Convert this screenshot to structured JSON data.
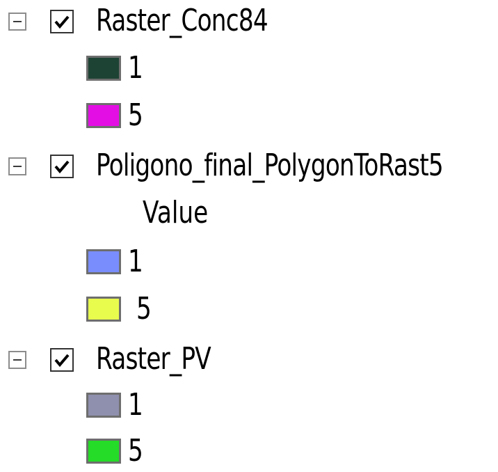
{
  "layers": [
    {
      "name": "Raster_Conc84",
      "checked": true,
      "expanded": true,
      "field": "",
      "classes": [
        {
          "label": "1",
          "color": "#1d4334"
        },
        {
          "label": "5",
          "color": "#e30ee3"
        }
      ]
    },
    {
      "name": "Poligono_final_PolygonToRast5",
      "checked": true,
      "expanded": true,
      "field": "Value",
      "classes": [
        {
          "label": "1",
          "color": "#7a8dfc"
        },
        {
          "label": "5",
          "color": "#e8fc4e"
        }
      ]
    },
    {
      "name": "Raster_PV",
      "checked": true,
      "expanded": true,
      "field": "",
      "classes": [
        {
          "label": "1",
          "color": "#8f8fae"
        },
        {
          "label": "5",
          "color": "#25dc28"
        }
      ]
    }
  ],
  "icons": {
    "expander": "minus-box-icon",
    "checkbox": "checkmark-icon"
  }
}
